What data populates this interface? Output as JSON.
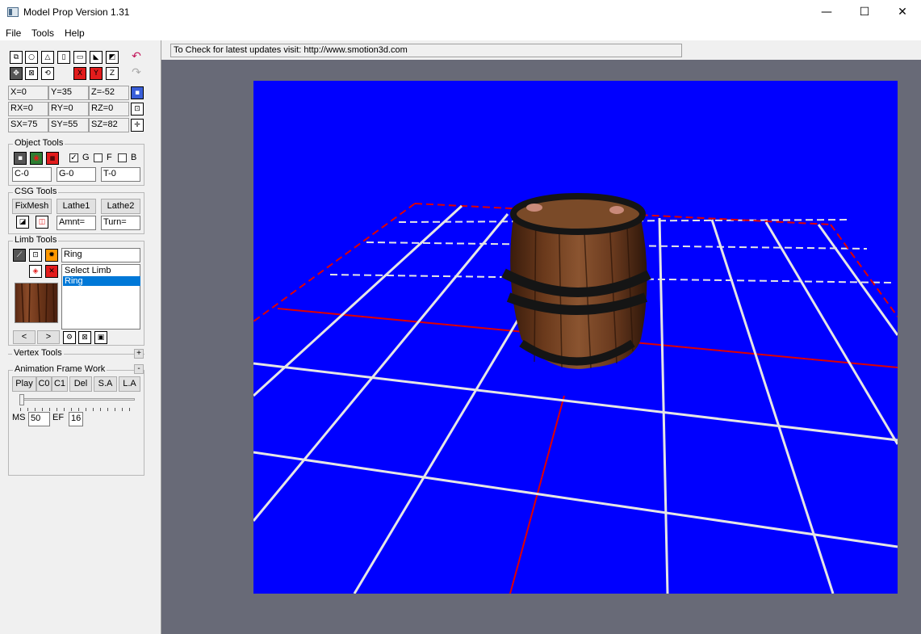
{
  "window": {
    "title": "Model Prop Version 1.31",
    "controls": {
      "minimize": "—",
      "maximize": "☐",
      "close": "✕"
    }
  },
  "menu": [
    "File",
    "Tools",
    "Help"
  ],
  "status": {
    "text": "To Check for latest updates visit: http://www.smotion3d.com"
  },
  "transform": {
    "x": "X=0",
    "y": "Y=35",
    "z": "Z=-52",
    "rx": "RX=0",
    "ry": "RY=0",
    "rz": "RZ=0",
    "sx": "SX=75",
    "sy": "SY=55",
    "sz": "SZ=82"
  },
  "axis_buttons": {
    "x": "X",
    "y": "Y",
    "z": "Z"
  },
  "object_tools": {
    "label": "Object Tools",
    "checks": [
      {
        "label": "G",
        "checked": true
      },
      {
        "label": "F",
        "checked": false
      },
      {
        "label": "B",
        "checked": false
      }
    ],
    "fields": {
      "c": "C-0",
      "g": "G-0",
      "t": "T-0"
    }
  },
  "csg_tools": {
    "label": "CSG Tools",
    "buttons": {
      "fixmesh": "FixMesh",
      "lathe1": "Lathe1",
      "lathe2": "Lathe2"
    },
    "fields": {
      "amnt": "Amnt=",
      "turn": "Turn="
    }
  },
  "limb_tools": {
    "label": "Limb Tools",
    "name_value": "Ring",
    "list": [
      {
        "label": "Select Limb",
        "selected": false
      },
      {
        "label": "Ring",
        "selected": true
      }
    ],
    "nav": {
      "prev": "<",
      "next": ">"
    }
  },
  "vertex_tools": {
    "label": "Vertex Tools",
    "toggle": "+"
  },
  "animation": {
    "label": "Animation Frame Work",
    "toggle": "-",
    "buttons": [
      "Play",
      "C0",
      "C1",
      "Del",
      "S.A",
      "L.A"
    ],
    "slider_value": 0,
    "ms_label": "MS",
    "ms_value": "50",
    "ef_label": "EF",
    "ef_value": "16"
  },
  "viewport": {
    "background_color": "#0000ff",
    "grid_color": "#e6e6e6",
    "axis_color": "#e00000",
    "object": "barrel"
  }
}
